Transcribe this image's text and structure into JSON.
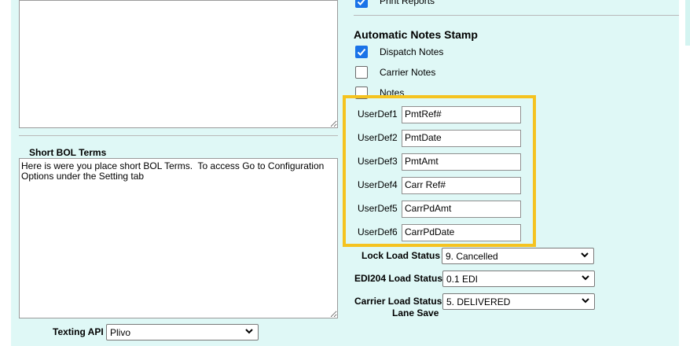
{
  "top_textarea": {
    "value": ""
  },
  "short_bol": {
    "label": "Short BOL Terms",
    "value": "Here is were you place short BOL Terms.  To access Go to Configuration Options under the Setting tab"
  },
  "texting_api": {
    "label": "Texting API",
    "selected": "Plivo"
  },
  "print_reports": {
    "label": "Print Reports",
    "checked": true
  },
  "notes_stamp": {
    "title": "Automatic Notes Stamp",
    "items": [
      {
        "label": "Dispatch Notes",
        "checked": true
      },
      {
        "label": "Carrier Notes",
        "checked": false
      },
      {
        "label": "Notes",
        "checked": false
      }
    ]
  },
  "userdefs": [
    {
      "label": "UserDef1",
      "value": "PmtRef#"
    },
    {
      "label": "UserDef2",
      "value": "PmtDate"
    },
    {
      "label": "UserDef3",
      "value": "PmtAmt"
    },
    {
      "label": "UserDef4",
      "value": "Carr Ref#"
    },
    {
      "label": "UserDef5",
      "value": "CarrPdAmt"
    },
    {
      "label": "UserDef6",
      "value": "CarrPdDate"
    }
  ],
  "status": {
    "lock": {
      "label": "Lock Load Status",
      "selected": "9. Cancelled"
    },
    "edi204": {
      "label": "EDI204 Load Status",
      "selected": "0.1 EDI"
    },
    "carrier": {
      "label": "Carrier Load Status",
      "selected": "5. DELIVERED"
    },
    "lane_save": {
      "label": "Lane Save"
    }
  },
  "colors": {
    "panel": "#dff8f6",
    "highlight": "#f5c320",
    "checkbox_on": "#1a73e8"
  }
}
